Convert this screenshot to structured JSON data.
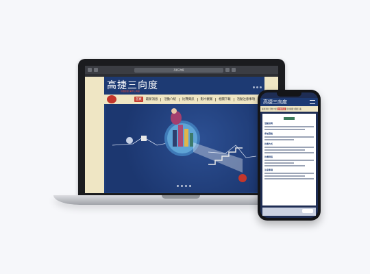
{
  "laptop": {
    "browser": {
      "url": "高捷三向度"
    },
    "site": {
      "title": "高捷三向度",
      "subtitle": "高雄捷運 美學三向度",
      "nav": [
        {
          "label": "首頁",
          "active": true
        },
        {
          "label": "最新消息",
          "active": false
        },
        {
          "label": "活動介紹",
          "active": false
        },
        {
          "label": "比賽資訊",
          "active": false
        },
        {
          "label": "影片觀賞",
          "active": false
        },
        {
          "label": "相關下載",
          "active": false
        },
        {
          "label": "活動注意事項",
          "active": false
        }
      ]
    }
  },
  "phone": {
    "site": {
      "title": "高捷三向度",
      "tabs": [
        {
          "label": "最新消息",
          "active": false
        },
        {
          "label": "活動介紹",
          "active": false
        },
        {
          "label": "比賽資訊",
          "active": true
        },
        {
          "label": "影片觀賞",
          "active": false
        },
        {
          "label": "相關下載",
          "active": false
        }
      ],
      "sections": [
        "活動說明",
        "參加資格",
        "比賽方式",
        "比賽時程",
        "注意事項"
      ]
    }
  },
  "colors": {
    "brand_navy": "#1d3a73",
    "nav_bg": "#efe6c4",
    "active_red": "#c44032"
  }
}
